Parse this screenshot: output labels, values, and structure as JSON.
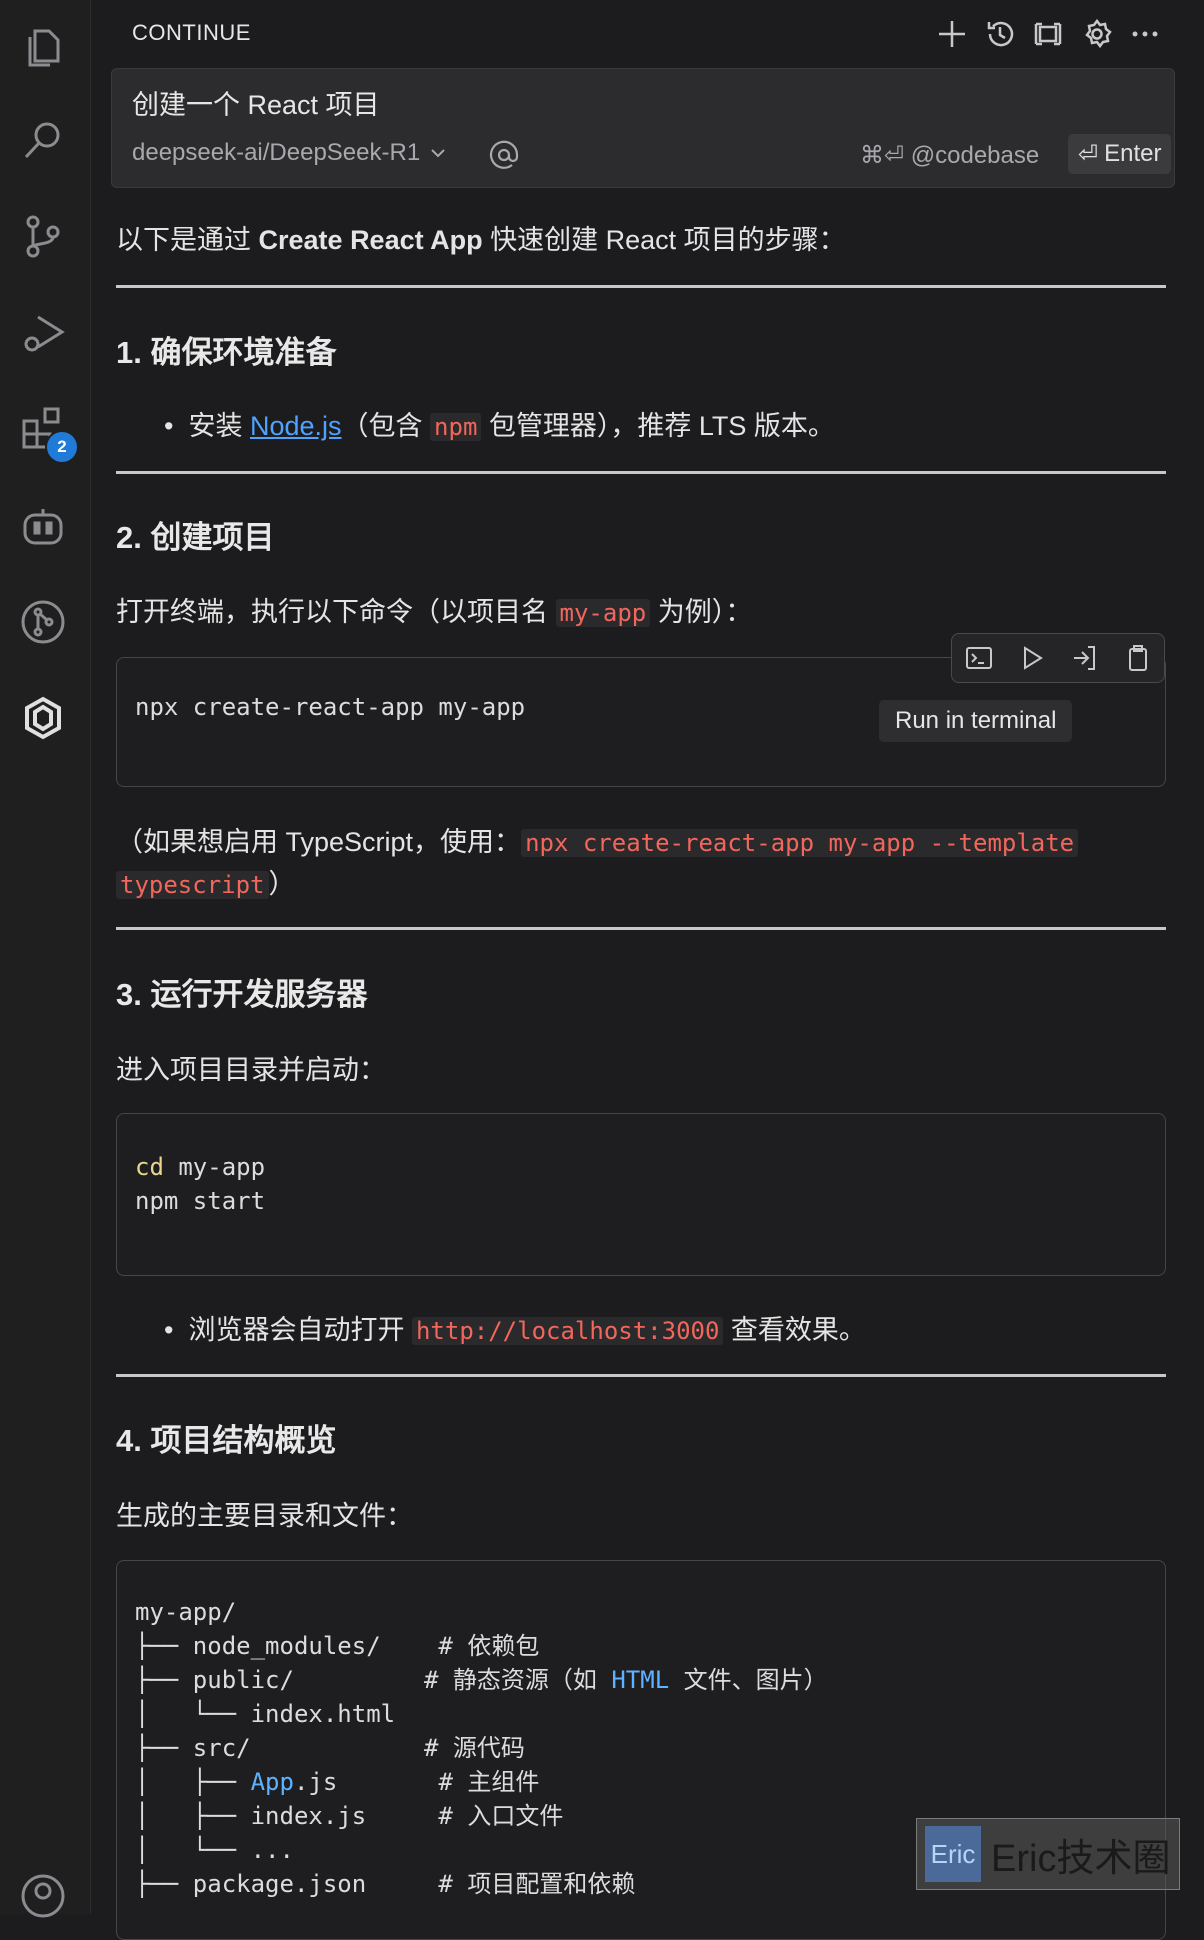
{
  "activity_bar": {
    "extensions_badge": "2"
  },
  "panel": {
    "title": "CONTINUE",
    "input": {
      "text": "创建一个 React 项目",
      "model": "deepseek-ai/DeepSeek-R1",
      "codebase_hint": "⌘⏎ @codebase",
      "enter_label": "Enter"
    }
  },
  "response": {
    "intro_pre": "以下是通过 ",
    "intro_bold": "Create React App",
    "intro_post": " 快速创建 React 项目的步骤：",
    "s1": {
      "heading": "1. 确保环境准备",
      "bullet_pre": "安装 ",
      "bullet_link": "Node.js",
      "bullet_mid": "（包含 ",
      "bullet_code": "npm",
      "bullet_post": " 包管理器），推荐 LTS 版本。"
    },
    "s2": {
      "heading": "2. 创建项目",
      "text_pre": "打开终端，执行以下命令（以项目名 ",
      "text_code": "my-app",
      "text_post": " 为例）：",
      "code": "npx create-react-app my-app",
      "tooltip": "Run in terminal",
      "note_pre": "（如果想启用 TypeScript，使用：",
      "note_code1": "npx create-react-app my-app --template",
      "note_code2": "typescript",
      "note_post": "）"
    },
    "s3": {
      "heading": "3. 运行开发服务器",
      "text": "进入项目目录并启动：",
      "code_line1_kw": "cd",
      "code_line1_rest": " my-app",
      "code_line2": "npm start",
      "bullet_pre": "浏览器会自动打开 ",
      "bullet_code": "http://localhost:3000",
      "bullet_post": " 查看效果。"
    },
    "s4": {
      "heading": "4. 项目结构概览",
      "text": "生成的主要目录和文件：",
      "tree": {
        "l1": "my-app/",
        "l2": "├── node_modules/    # 依赖包",
        "l3_pre": "├── public/         # 静态资源（如 ",
        "l3_blue": "HTML",
        "l3_post": " 文件、图片）",
        "l4": "│   └── index.html",
        "l5": "├── src/            # 源代码",
        "l6_pre": "│   ├── ",
        "l6_blue": "App",
        "l6_post": ".js       # 主组件",
        "l7": "│   ├── index.js     # 入口文件",
        "l8": "│   └── ...",
        "l9": "├── package.json     # 项目配置和依赖"
      }
    }
  },
  "watermark": {
    "logo": "Eric",
    "text": "Eric技术圈"
  }
}
